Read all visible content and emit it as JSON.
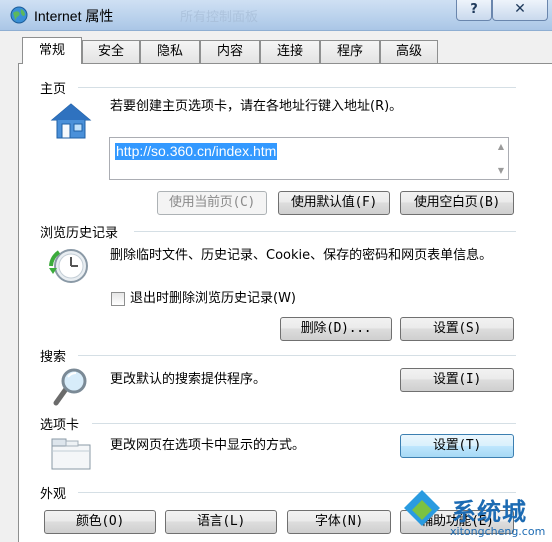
{
  "window": {
    "title": "Internet 属性",
    "ghost_title": "所有控制面板",
    "help_label": "?",
    "close_label": "✕",
    "icon": "globe-icon"
  },
  "tabs": [
    {
      "label": "常规",
      "active": true
    },
    {
      "label": "安全"
    },
    {
      "label": "隐私"
    },
    {
      "label": "内容"
    },
    {
      "label": "连接"
    },
    {
      "label": "程序"
    },
    {
      "label": "高级"
    }
  ],
  "home_page": {
    "title": "主页",
    "description": "若要创建主页选项卡，请在各地址行键入地址(R)。",
    "address": "http://so.360.cn/index.htm",
    "use_current": "使用当前页(C)",
    "use_default": "使用默认值(F)",
    "use_blank": "使用空白页(B)",
    "icon": "home-icon"
  },
  "history": {
    "title": "浏览历史记录",
    "description": "删除临时文件、历史记录、Cookie、保存的密码和网页表单信息。",
    "checkbox_label": "退出时删除浏览历史记录(W)",
    "checkbox_checked": false,
    "delete_btn": "删除(D)...",
    "settings_btn": "设置(S)",
    "icon": "history-clock-icon"
  },
  "search": {
    "title": "搜索",
    "description": "更改默认的搜索提供程序。",
    "settings_btn": "设置(I)",
    "icon": "magnifier-icon"
  },
  "tabs_section": {
    "title": "选项卡",
    "description": "更改网页在选项卡中显示的方式。",
    "settings_btn": "设置(T)",
    "icon": "tabbed-window-icon"
  },
  "appearance": {
    "title": "外观",
    "colors_btn": "颜色(O)",
    "languages_btn": "语言(L)",
    "fonts_btn": "字体(N)",
    "accessibility_btn": "辅助功能(E)"
  },
  "watermark": {
    "brand": "系统城",
    "url": "xitongcheng.com"
  }
}
